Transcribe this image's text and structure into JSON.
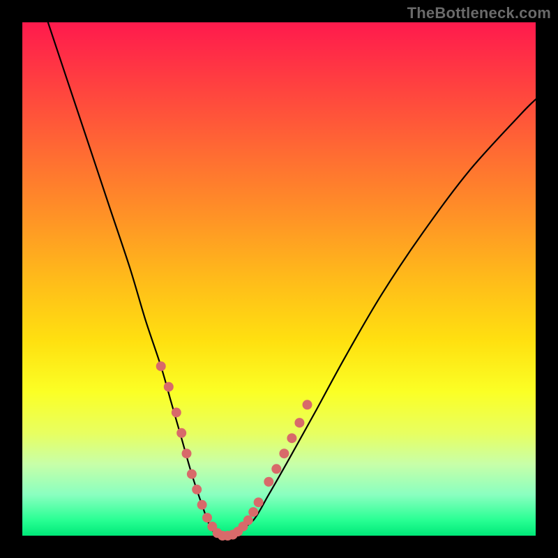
{
  "watermark": "TheBottleneck.com",
  "colors": {
    "background_frame": "#000000",
    "gradient_top": "#ff1a4d",
    "gradient_bottom": "#00e878",
    "curve": "#000000",
    "markers": "#d86a6a",
    "watermark_text": "#6a6a6a"
  },
  "chart_data": {
    "type": "line",
    "title": "",
    "xlabel": "",
    "ylabel": "",
    "xlim": [
      0,
      100
    ],
    "ylim": [
      0,
      100
    ],
    "grid": false,
    "legend": false,
    "series": [
      {
        "name": "bottleneck-curve",
        "x": [
          5,
          9,
          13,
          17,
          21,
          24,
          27,
          29,
          31,
          33,
          35,
          36.5,
          38,
          40,
          42,
          45,
          48,
          52,
          57,
          63,
          70,
          78,
          87,
          97,
          100
        ],
        "y": [
          100,
          88,
          76,
          64,
          52,
          42,
          33,
          26,
          19,
          12,
          6,
          2,
          0,
          0,
          1,
          3,
          8,
          15,
          24,
          35,
          47,
          59,
          71,
          82,
          85
        ]
      }
    ],
    "markers": {
      "name": "highlight-dots",
      "x": [
        27,
        28.5,
        30,
        31,
        32,
        33,
        34,
        35,
        36,
        37,
        38,
        39,
        40,
        41,
        42,
        43,
        44,
        45,
        46,
        48,
        49.5,
        51,
        52.5,
        54,
        55.5
      ],
      "y": [
        33,
        29,
        24,
        20,
        16,
        12,
        9,
        6,
        3.5,
        1.8,
        0.5,
        0,
        0,
        0.2,
        0.8,
        1.8,
        3,
        4.6,
        6.5,
        10.5,
        13,
        16,
        19,
        22,
        25.5
      ],
      "r": 7
    },
    "minimum": {
      "x": 39,
      "y": 0
    }
  }
}
